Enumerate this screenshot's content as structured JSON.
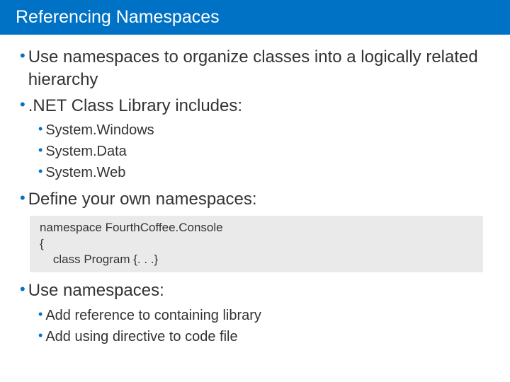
{
  "title": "Referencing Namespaces",
  "bullets": {
    "b1": "Use namespaces to organize classes into a logically related hierarchy",
    "b2": ".NET Class Library includes:",
    "b2_subs": {
      "s1": "System.Windows",
      "s2": "System.Data",
      "s3": "System.Web"
    },
    "b3": "Define your own namespaces:",
    "code": "namespace FourthCoffee.Console\n{\n    class Program {. . .}",
    "b4": "Use namespaces:",
    "b4_subs": {
      "s1": "Add reference to containing library",
      "s2": "Add using directive to code file"
    }
  }
}
